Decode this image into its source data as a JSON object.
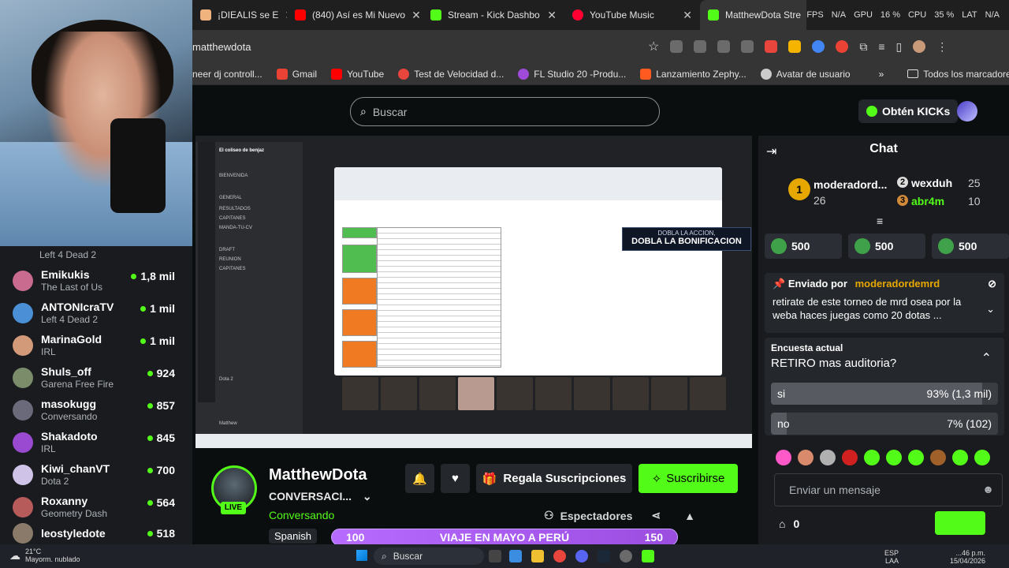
{
  "browser": {
    "tabs": [
      {
        "label": "¡DIEALIS se E",
        "color": "#f0b37e"
      },
      {
        "label": "(840) Así es Mi Nuevo",
        "color": "#ff0000"
      },
      {
        "label": "Stream - Kick Dashbo",
        "color": "#53fc18"
      },
      {
        "label": "YouTube Music",
        "color": "#ff0033"
      },
      {
        "label": "MatthewDota Stre",
        "color": "#53fc18"
      }
    ],
    "sys_stats": [
      "FPS",
      "N/A",
      "GPU",
      "16 %",
      "CPU",
      "35 %",
      "LAT",
      "N/A"
    ],
    "url": "matthewdota",
    "bookmarks": [
      {
        "label": "neer dj controll...",
        "color": "#888888"
      },
      {
        "label": "Gmail",
        "color": "#ea4335"
      },
      {
        "label": "YouTube",
        "color": "#ff0000"
      },
      {
        "label": "Test de Velocidad d...",
        "color": "#e8453c"
      },
      {
        "label": "FL Studio 20 -Produ...",
        "color": "#a04ad9"
      },
      {
        "label": "Lanzamiento Zephy...",
        "color": "#ff5a1f"
      },
      {
        "label": "Avatar de usuario",
        "color": "#cccccc"
      }
    ],
    "all_bookmarks": "Todos los marcadores",
    "more_bookmarks": "»"
  },
  "kick": {
    "search_placeholder": "Buscar",
    "kicks_button": "Obtén KICKs",
    "brand_color": "#53fc18"
  },
  "sidebar": {
    "first_category": "Left 4 Dead 2",
    "channels": [
      {
        "name": "Emikukis",
        "category": "The Last of Us",
        "viewers": "1,8 mil",
        "color": "#c86b8f"
      },
      {
        "name": "ANTONIcraTV",
        "category": "Left 4 Dead 2",
        "viewers": "1 mil",
        "color": "#4b8fd6"
      },
      {
        "name": "MarinaGold",
        "category": "IRL",
        "viewers": "1 mil",
        "color": "#d39a7a"
      },
      {
        "name": "Shuls_off",
        "category": "Garena Free Fire",
        "viewers": "924",
        "color": "#7a8c6a"
      },
      {
        "name": "masokugg",
        "category": "Conversando",
        "viewers": "857",
        "color": "#6a6a7a"
      },
      {
        "name": "Shakadoto",
        "category": "IRL",
        "viewers": "845",
        "color": "#9a4ad0"
      },
      {
        "name": "Kiwi_chanVT",
        "category": "Dota 2",
        "viewers": "700",
        "color": "#d0c3e8"
      },
      {
        "name": "Roxanny",
        "category": "Geometry Dash",
        "viewers": "564",
        "color": "#b65a5a"
      },
      {
        "name": "leostyledote",
        "category": "",
        "viewers": "518",
        "color": "#8a7a6a"
      }
    ]
  },
  "video": {
    "banner_small": "DOBLA LA ACCION,",
    "banner_big": "DOBLA LA BONIFICACION",
    "discord_server": "El coliseo de benjaz",
    "discord_items": [
      "BIENVENIDA",
      "GENERAL",
      "RESULTADOS",
      "CAPITANES",
      "MANDA-TU-CV",
      "DRAFT",
      "REUNION",
      "CAPITANES",
      "Dota 2",
      "Matthew"
    ]
  },
  "stream": {
    "channel_name": "MatthewDota",
    "title": "CONVERSACI...",
    "category": "Conversando",
    "language": "Spanish",
    "live": "LIVE",
    "gift_subs": "Regala Suscripciones",
    "subscribe": "Suscribirse",
    "viewers_label": "Espectadores",
    "goal_start": "100",
    "goal_text": "VIAJE EN MAYO A PERÚ",
    "goal_end": "150"
  },
  "chat": {
    "title": "Chat",
    "leaderboard": [
      {
        "rank": "1",
        "name": "moderadord...",
        "count": "26"
      },
      {
        "rank": "2",
        "name": "wexduh",
        "count": "25"
      },
      {
        "rank": "3",
        "name": "abr4m",
        "count": "10"
      }
    ],
    "gifts": [
      "500",
      "500",
      "500"
    ],
    "pinned_by": "Enviado por",
    "pinned_user": "moderadordemrd",
    "pinned_text": "retirate de este torneo de mrd osea por la weba haces juegas como 20 dotas ...",
    "poll_label": "Encuesta actual",
    "poll_question": "RETIRO mas auditoria?",
    "poll_options": [
      {
        "label": "si",
        "result": "93% (1,3 mil)",
        "fraction": 0.93
      },
      {
        "label": "no",
        "result": "7% (102)",
        "fraction": 0.07
      }
    ],
    "input_placeholder": "Enviar un mensaje",
    "kicks_balance": "0",
    "emote_colors": [
      "#ff58c8",
      "#d98a6c",
      "#b0b0b0",
      "#d02020",
      "#53fc18",
      "#53fc18",
      "#53fc18",
      "#a0602a",
      "#53fc18",
      "#53fc18"
    ]
  },
  "taskbar": {
    "weather_temp": "21°C",
    "weather_desc": "Mayorm. nublado",
    "search": "Buscar",
    "lang": "ESP",
    "lang2": "LAA",
    "time": "...46 p.m.",
    "date": "15/04/2026"
  }
}
